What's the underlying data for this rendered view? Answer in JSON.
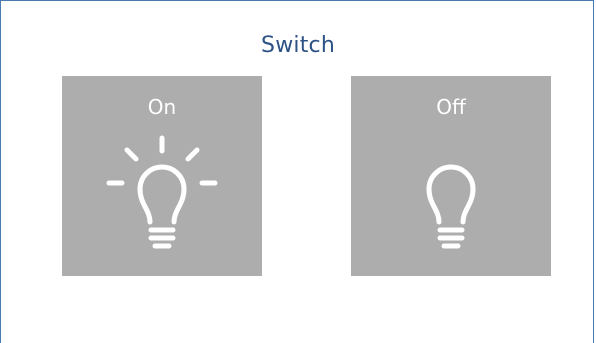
{
  "panel": {
    "title": "Switch",
    "border_color": "#4a7ab0",
    "title_color": "#2d5286"
  },
  "buttons": [
    {
      "label": "On",
      "icon": "lightbulb-on-icon",
      "state": "on"
    },
    {
      "label": "Off",
      "icon": "lightbulb-off-icon",
      "state": "off"
    }
  ],
  "colors": {
    "tile_background": "#adadad",
    "icon_and_text": "#ffffff"
  }
}
